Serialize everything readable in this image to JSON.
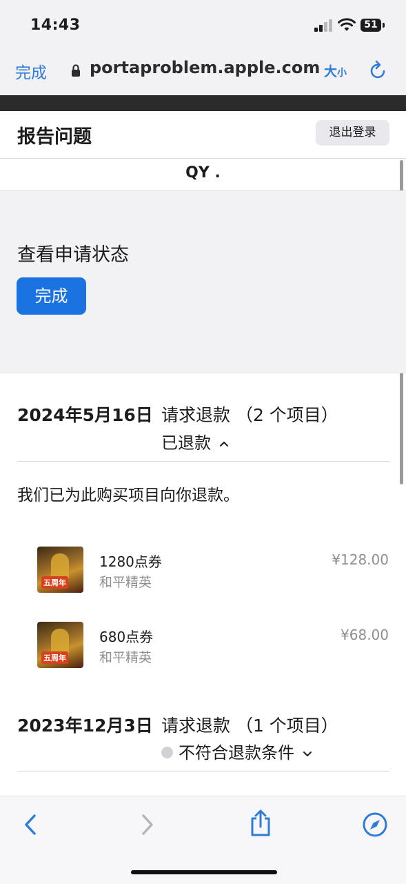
{
  "status_bar": {
    "time": "14:43",
    "battery": "51"
  },
  "browser": {
    "done_label": "完成",
    "url": "portaproblem.apple.com",
    "text_size_big": "大",
    "text_size_small": "小"
  },
  "header": {
    "title": "报告问题",
    "sign_out_label": "退出登录"
  },
  "user": {
    "name": "QY ."
  },
  "status_panel": {
    "title": "查看申请状态",
    "done_label": "完成"
  },
  "orders": [
    {
      "date": "2024年5月16日",
      "request": "请求退款 （2 个项目）",
      "status": "已退款",
      "message": "我们已为此购买项目向你退款。",
      "items": [
        {
          "name": "1280点券",
          "app": "和平精英",
          "price": "¥128.00",
          "icon_badge": "五周年"
        },
        {
          "name": "680点券",
          "app": "和平精英",
          "price": "¥68.00",
          "icon_badge": "五周年"
        }
      ]
    },
    {
      "date": "2023年12月3日",
      "request": "请求退款 （1 个项目）",
      "status": "不符合退款条件"
    }
  ],
  "colors": {
    "accent": "#1a73e0",
    "link": "#2f7bd9",
    "muted": "#8e8e93"
  },
  "toolbar_icons": [
    "back-icon",
    "forward-icon",
    "share-icon",
    "compass-icon"
  ]
}
